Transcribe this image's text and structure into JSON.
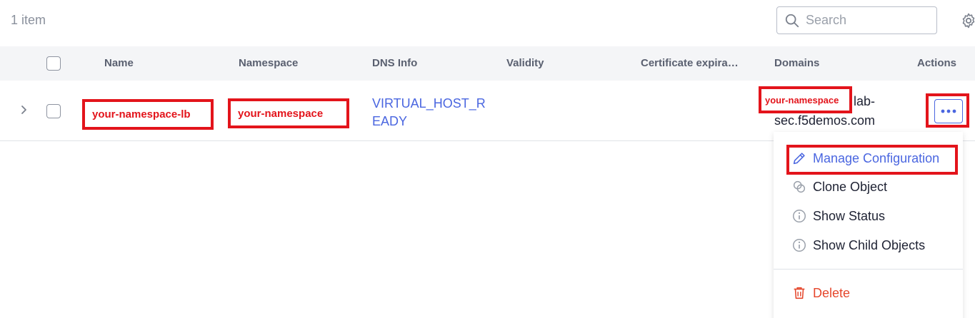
{
  "header": {
    "item_count": "1 item",
    "search_placeholder": "Search"
  },
  "table": {
    "columns": [
      "Name",
      "Namespace",
      "DNS Info",
      "Validity",
      "Certificate expira…",
      "Domains",
      "Actions"
    ],
    "rows": [
      {
        "name": "your-namespace-lb",
        "namespace": "your-namespace",
        "dns_info": "VIRTUAL_HOST_READY",
        "validity": "",
        "certificate_expiration": "",
        "domains": {
          "prefix_label": "your-namespace",
          "suffix_line1": "lab-",
          "suffix_line2": "sec.f5demos.com"
        }
      }
    ]
  },
  "actions_menu": {
    "items": [
      {
        "label": "Manage Configuration",
        "icon": "pencil-icon"
      },
      {
        "label": "Clone Object",
        "icon": "clone-icon"
      },
      {
        "label": "Show Status",
        "icon": "info-icon"
      },
      {
        "label": "Show Child Objects",
        "icon": "info-icon"
      },
      {
        "label": "Delete",
        "icon": "trash-icon"
      }
    ]
  },
  "colors": {
    "accent": "#4a66e0",
    "highlight": "#e3141b",
    "danger": "#e5472c"
  }
}
